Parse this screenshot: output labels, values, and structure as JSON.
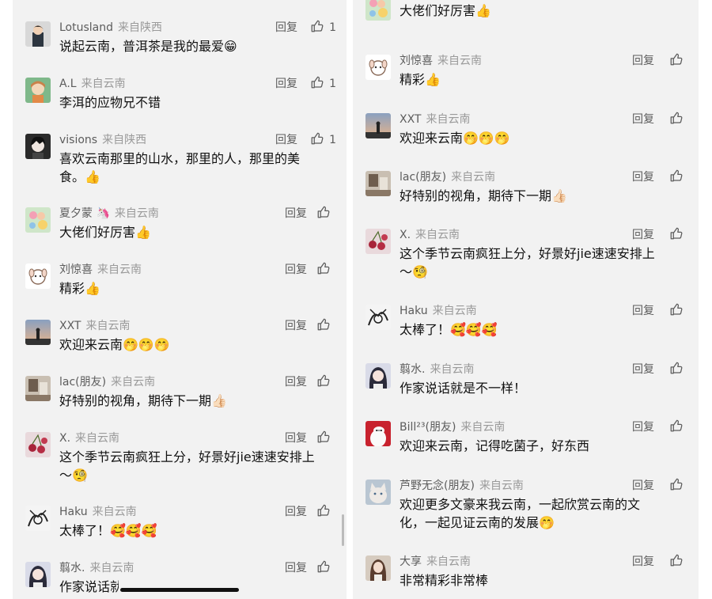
{
  "left_panel": {
    "comments": [
      {
        "name": "Lotusland",
        "from": "来自陕西",
        "text": "说起云南，普洱茶是我的最爱😁",
        "reply_label": "回复",
        "like_count": "1",
        "avatar_icon": "avatar-man-icon"
      },
      {
        "name": "A.L",
        "from": "来自云南",
        "text": "李洱的应物兄不错",
        "reply_label": "回复",
        "like_count": "1",
        "avatar_icon": "avatar-cartoon-girl-icon"
      },
      {
        "name": "visions",
        "from": "来自陕西",
        "text": "喜欢云南那里的山水，那里的人，那里的美",
        "text2": "食。👍",
        "reply_label": "回复",
        "like_count": "1",
        "avatar_icon": "avatar-anime-boy-icon"
      },
      {
        "name": "夏夕蒙",
        "name_emoji": "🦄",
        "from": "来自云南",
        "text": "大佬们好厉害👍",
        "reply_label": "回复",
        "avatar_icon": "avatar-flowers-icon"
      },
      {
        "name": "刘惊喜",
        "from": "来自云南",
        "text": "精彩👍",
        "reply_label": "回复",
        "avatar_icon": "avatar-dog-icon"
      },
      {
        "name": "XXT",
        "from": "来自云南",
        "text": "欢迎来云南🤭🤭🤭",
        "reply_label": "回复",
        "avatar_icon": "avatar-sunset-icon"
      },
      {
        "name": "lac(朋友)",
        "from": "来自云南",
        "text": "好特别的视角，期待下一期👍🏻",
        "reply_label": "回复",
        "avatar_icon": "avatar-room-icon"
      },
      {
        "name": "X.",
        "from": "来自云南",
        "text": "这个季节云南疯狂上分，好景好jie速速安排上",
        "text2": "～🧐",
        "reply_label": "回复",
        "avatar_icon": "avatar-cherries-icon"
      },
      {
        "name": "Haku",
        "from": "来自云南",
        "text": "太棒了！🥰🥰🥰",
        "reply_label": "回复",
        "avatar_icon": "avatar-sketch-icon"
      },
      {
        "name": "翦水.",
        "from": "来自云南",
        "text": "作家说话就是不一样！",
        "reply_label": "回复",
        "avatar_icon": "avatar-anime-girl-icon"
      }
    ]
  },
  "right_panel": {
    "comments": [
      {
        "text": "大佬们好厉害👍",
        "reply_label": "回复",
        "avatar_icon": "avatar-flowers-icon"
      },
      {
        "name": "刘惊喜",
        "from": "来自云南",
        "text": "精彩👍",
        "reply_label": "回复",
        "avatar_icon": "avatar-dog-icon"
      },
      {
        "name": "XXT",
        "from": "来自云南",
        "text": "欢迎来云南🤭🤭🤭",
        "reply_label": "回复",
        "avatar_icon": "avatar-sunset-icon"
      },
      {
        "name": "lac(朋友)",
        "from": "来自云南",
        "text": "好特别的视角，期待下一期👍🏻",
        "reply_label": "回复",
        "avatar_icon": "avatar-room-icon"
      },
      {
        "name": "X.",
        "from": "来自云南",
        "text": "这个季节云南疯狂上分，好景好jie速速安排上",
        "text2": "～🧐",
        "reply_label": "回复",
        "avatar_icon": "avatar-cherries-icon"
      },
      {
        "name": "Haku",
        "from": "来自云南",
        "text": "太棒了！🥰🥰🥰",
        "reply_label": "回复",
        "avatar_icon": "avatar-sketch-icon"
      },
      {
        "name": "翦水.",
        "from": "来自云南",
        "text": "作家说话就是不一样！",
        "reply_label": "回复",
        "avatar_icon": "avatar-anime-girl-icon"
      },
      {
        "name": "Bill²³(朋友)",
        "from": "来自云南",
        "text": "欢迎来云南，记得吃菌子，好东西",
        "reply_label": "回复",
        "avatar_icon": "avatar-baymax-icon"
      },
      {
        "name": "芦野无念(朋友)",
        "from": "来自云南",
        "text": "欢迎更多文豪来我云南，一起欣赏云南的文",
        "text2": "化，一起见证云南的发展🤭",
        "reply_label": "回复",
        "avatar_icon": "avatar-cat-icon"
      },
      {
        "name": "大享",
        "from": "来自云南",
        "text": "非常精彩非常棒",
        "reply_label": "回复",
        "avatar_icon": "avatar-woman-icon"
      }
    ]
  },
  "icons": {
    "like": "thumbs-up-icon"
  },
  "colors": {
    "panel_bg": "#f2f2f2",
    "meta": "#9a9a9a",
    "name": "#5c5c5c",
    "text": "#111111"
  }
}
